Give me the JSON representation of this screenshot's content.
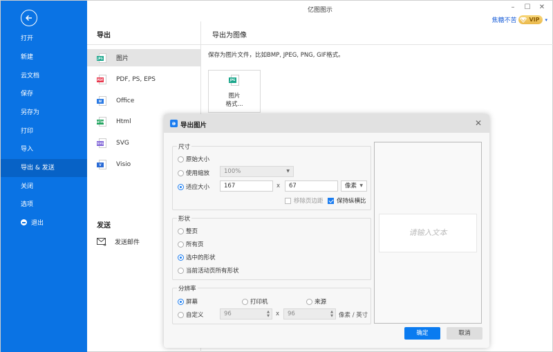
{
  "app": {
    "title": "亿图图示",
    "window_controls": {
      "minimize": "–",
      "maximize": "☐",
      "close": "✕"
    },
    "user": {
      "name": "焦糖不苦",
      "badge": "VIP",
      "caret": "▾"
    }
  },
  "sidebar": {
    "back_icon": "back-arrow-icon",
    "items": [
      {
        "label": "打开"
      },
      {
        "label": "新建"
      },
      {
        "label": "云文档"
      },
      {
        "label": "保存"
      },
      {
        "label": "另存为"
      },
      {
        "label": "打印"
      },
      {
        "label": "导入"
      },
      {
        "label": "导出 & 发送",
        "active": true
      },
      {
        "label": "关闭"
      },
      {
        "label": "选项"
      },
      {
        "label": "退出",
        "icon": "exit-icon"
      }
    ],
    "colors": {
      "background": "#0a73e4",
      "active": "#0762c6"
    }
  },
  "export": {
    "heading": "导出",
    "formats": [
      {
        "label": "图片",
        "tag": "JPG",
        "color": "#18a58a",
        "active": true
      },
      {
        "label": "PDF, PS, EPS",
        "tag": "PDF",
        "color": "#e8344a"
      },
      {
        "label": "Office",
        "tag": "W",
        "color": "#2a7ae4"
      },
      {
        "label": "Html",
        "tag": "HTML",
        "color": "#18a058"
      },
      {
        "label": "SVG",
        "tag": "SVG",
        "color": "#7b5ed6"
      },
      {
        "label": "Visio",
        "tag": "V",
        "color": "#2a6bd6"
      }
    ],
    "send_heading": "发送",
    "send_items": [
      {
        "label": "发送邮件",
        "icon": "mail-send-icon"
      }
    ]
  },
  "right_pane": {
    "heading": "导出为图像",
    "description": "保存为图片文件，比如BMP, JPEG, PNG, GIF格式。",
    "card": {
      "tag": "JPG",
      "line1": "图片",
      "line2": "格式..."
    }
  },
  "dialog": {
    "title": "导出图片",
    "icon_glyph": "ə",
    "close": "✕",
    "size_group": {
      "legend": "尺寸",
      "options": [
        {
          "label": "原始大小",
          "checked": false
        },
        {
          "label": "使用缩放",
          "checked": false
        },
        {
          "label": "适应大小",
          "checked": true
        }
      ],
      "zoom_select": "100%",
      "width": "167",
      "height": "67",
      "times": "x",
      "unit_select": "像素",
      "remove_margin": {
        "label": "移除页边距",
        "checked": false,
        "disabled": true
      },
      "keep_ratio": {
        "label": "保持纵横比",
        "checked": true
      }
    },
    "shape_group": {
      "legend": "形状",
      "options": [
        {
          "label": "整页",
          "checked": false
        },
        {
          "label": "所有页",
          "checked": false
        },
        {
          "label": "选中的形状",
          "checked": true
        },
        {
          "label": "当前活动页所有形状",
          "checked": false
        }
      ]
    },
    "resolution_group": {
      "legend": "分辨率",
      "options": [
        {
          "label": "屏幕",
          "checked": true
        },
        {
          "label": "打印机",
          "checked": false
        },
        {
          "label": "来源",
          "checked": false
        },
        {
          "label": "自定义",
          "checked": false
        }
      ],
      "dpi_x": "96",
      "dpi_y": "96",
      "times": "x",
      "unit": "像素 / 英寸"
    },
    "preview_placeholder": "请输入文本",
    "ok_label": "确定",
    "cancel_label": "取消",
    "accent": "#0a7bf0"
  }
}
